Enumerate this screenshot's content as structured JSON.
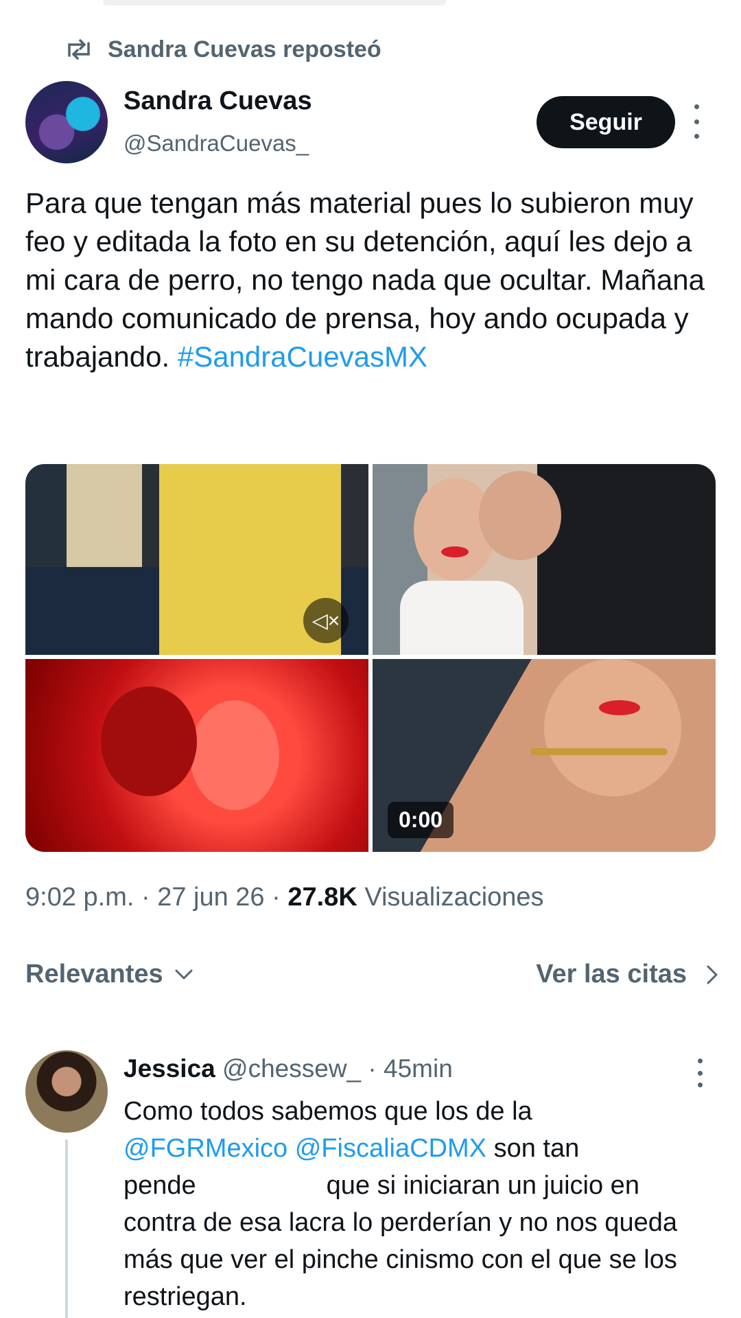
{
  "repost": {
    "icon": "repost-icon",
    "label": "Sandra Cuevas reposteó"
  },
  "tweet": {
    "author_name": "Sandra Cuevas",
    "author_handle": "@SandraCuevas_",
    "follow_label": "Seguir",
    "text": "Para que tengan más material pues lo subieron muy feo y editada la foto en su detención, aquí les dejo a mi cara de perro, no tengo nada que ocultar. Mañana mando comunicado de prensa, hoy ando ocupada y trabajando.",
    "hashtag": "#SandraCuevasMX",
    "video_time": "0:00",
    "time": "9:02 p.m.",
    "date": "27 jun 26",
    "views_count": "27.8K",
    "views_label": "Visualizaciones"
  },
  "filters": {
    "sort_label": "Relevantes",
    "quotes_label": "Ver las citas"
  },
  "reply": {
    "name": "Jessica",
    "handle": "@chessew_",
    "age": "45min",
    "text_part1": "Como todos sabemos que los de la",
    "mention1": "@FGRMexico",
    "mention2": "@FiscaliaCDMX",
    "text_part2": "son tan",
    "text_part3": "pende",
    "text_part4": "que si iniciaran un juicio en contra de esa lacra lo perderían y no nos queda más que ver el pinche cinismo con el que se los restriegan."
  },
  "colors": {
    "accent": "#1d9bf0",
    "muted": "#536471",
    "text": "#0f1419"
  }
}
